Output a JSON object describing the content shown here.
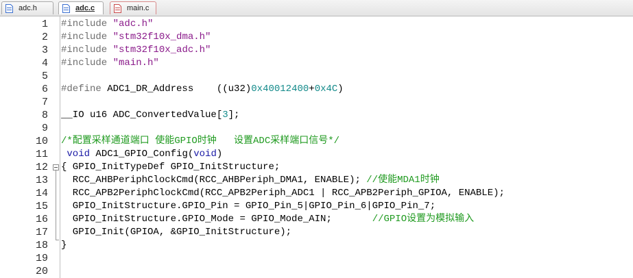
{
  "tabs": [
    {
      "label": "adc.h",
      "active": false,
      "color": "#2a5fc1"
    },
    {
      "label": "adc.c",
      "active": true,
      "color": "#2a5fc1"
    },
    {
      "label": "main.c",
      "active": false,
      "color": "#c94a4a"
    }
  ],
  "lines": [
    {
      "n": "1",
      "segs": [
        {
          "t": "#include ",
          "c": "kw-pre"
        },
        {
          "t": "\"adc.h\"",
          "c": "str"
        }
      ]
    },
    {
      "n": "2",
      "segs": [
        {
          "t": "#include ",
          "c": "kw-pre"
        },
        {
          "t": "\"stm32f10x_dma.h\"",
          "c": "str"
        }
      ]
    },
    {
      "n": "3",
      "segs": [
        {
          "t": "#include ",
          "c": "kw-pre"
        },
        {
          "t": "\"stm32f10x_adc.h\"",
          "c": "str"
        }
      ]
    },
    {
      "n": "4",
      "segs": [
        {
          "t": "#include ",
          "c": "kw-pre"
        },
        {
          "t": "\"main.h\"",
          "c": "str"
        }
      ]
    },
    {
      "n": "5",
      "segs": []
    },
    {
      "n": "6",
      "segs": [
        {
          "t": "#define ",
          "c": "kw-pre"
        },
        {
          "t": "ADC1_DR_Address    ((u32)",
          "c": ""
        },
        {
          "t": "0x40012400",
          "c": "num"
        },
        {
          "t": "+",
          "c": ""
        },
        {
          "t": "0x4C",
          "c": "num"
        },
        {
          "t": ")",
          "c": ""
        }
      ]
    },
    {
      "n": "7",
      "segs": []
    },
    {
      "n": "8",
      "segs": [
        {
          "t": "__IO u16 ADC_ConvertedValue[",
          "c": ""
        },
        {
          "t": "3",
          "c": "num"
        },
        {
          "t": "];",
          "c": ""
        }
      ]
    },
    {
      "n": "9",
      "segs": []
    },
    {
      "n": "10",
      "segs": [
        {
          "t": "/*配置采样通道端口 使能GPIO时钟   设置ADC采样端口信号*/",
          "c": "cmt"
        }
      ]
    },
    {
      "n": "11",
      "segs": [
        {
          "t": " ",
          "c": ""
        },
        {
          "t": "void",
          "c": "kw"
        },
        {
          "t": " ADC1_GPIO_Config(",
          "c": ""
        },
        {
          "t": "void",
          "c": "kw"
        },
        {
          "t": ")",
          "c": ""
        }
      ]
    },
    {
      "n": "12",
      "segs": [
        {
          "t": "{ GPIO_InitTypeDef GPIO_InitStructure;",
          "c": ""
        }
      ]
    },
    {
      "n": "13",
      "segs": [
        {
          "t": "  RCC_AHBPeriphClockCmd(RCC_AHBPeriph_DMA1, ENABLE); ",
          "c": ""
        },
        {
          "t": "//使能MDA1时钟",
          "c": "cmt"
        }
      ]
    },
    {
      "n": "14",
      "segs": [
        {
          "t": "  RCC_APB2PeriphClockCmd(RCC_APB2Periph_ADC1 | RCC_APB2Periph_GPIOA, ENABLE);",
          "c": ""
        }
      ]
    },
    {
      "n": "15",
      "segs": [
        {
          "t": "  GPIO_InitStructure.GPIO_Pin = GPIO_Pin_5|GPIO_Pin_6|GPIO_Pin_7;",
          "c": ""
        }
      ]
    },
    {
      "n": "16",
      "segs": [
        {
          "t": "  GPIO_InitStructure.GPIO_Mode = GPIO_Mode_AIN;       ",
          "c": ""
        },
        {
          "t": "//GPIO设置为模拟输入",
          "c": "cmt"
        }
      ]
    },
    {
      "n": "17",
      "segs": [
        {
          "t": "  GPIO_Init(GPIOA, &GPIO_InitStructure);",
          "c": ""
        }
      ]
    },
    {
      "n": "18",
      "segs": [
        {
          "t": "}",
          "c": ""
        }
      ]
    },
    {
      "n": "19",
      "segs": []
    },
    {
      "n": "20",
      "segs": []
    }
  ]
}
